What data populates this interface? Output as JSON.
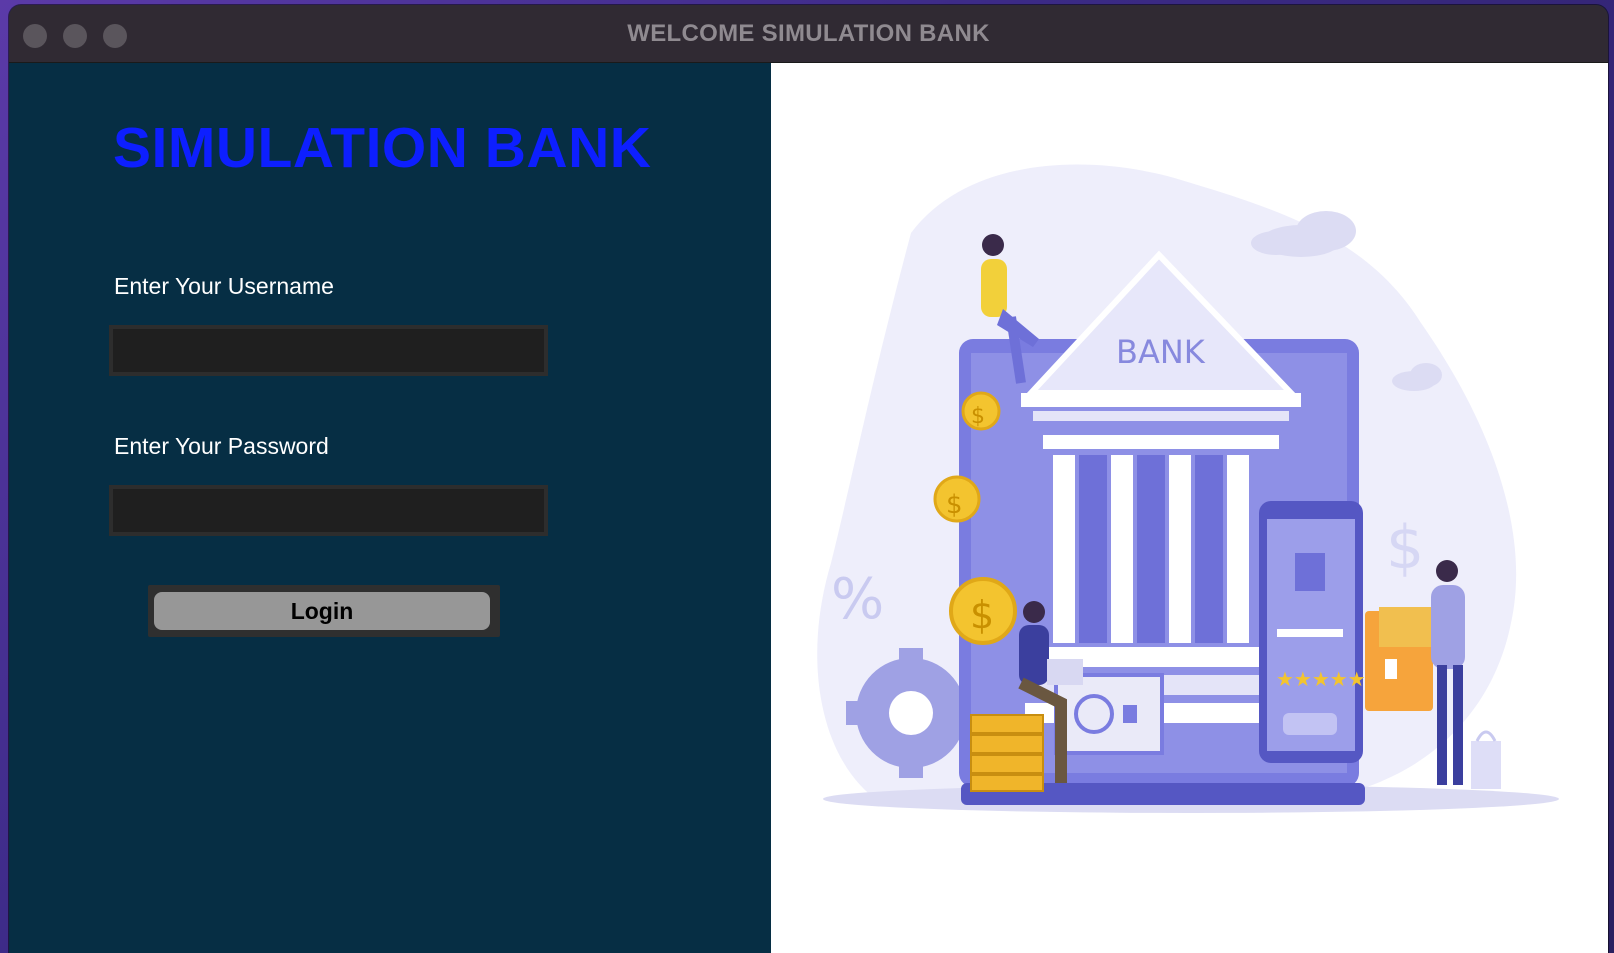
{
  "window": {
    "title": "WELCOME SIMULATION BANK"
  },
  "login": {
    "heading": "SIMULATION BANK",
    "username_label": "Enter Your Username",
    "username_value": "",
    "password_label": "Enter Your Password",
    "password_value": "",
    "login_button": "Login"
  },
  "illustration": {
    "sign_text": "BANK",
    "icons": [
      "percent-icon",
      "dollar-icon",
      "gear-icon",
      "coin-icon",
      "banknote-icon",
      "phone-icon",
      "card-icon",
      "bag-icon"
    ]
  },
  "colors": {
    "panel": "#062e44",
    "heading": "#0d1fff",
    "accent": "#6e6fd8",
    "coin": "#f3c42f"
  }
}
